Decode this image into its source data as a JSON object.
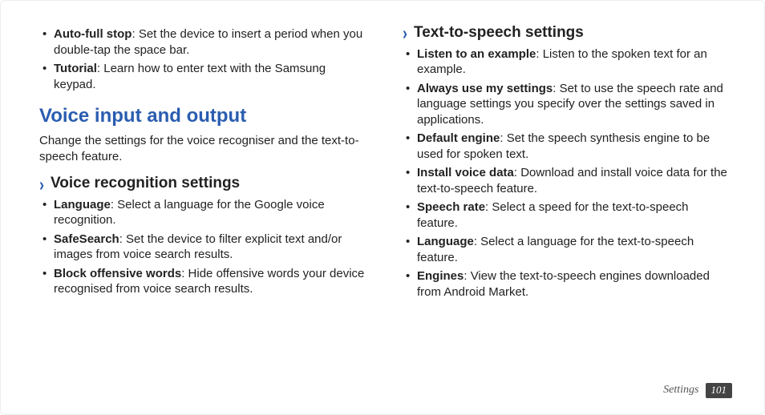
{
  "left": {
    "top_bullets": [
      {
        "term": "Auto-full stop",
        "desc": ": Set the device to insert a period when you double-tap the space bar."
      },
      {
        "term": "Tutorial",
        "desc": ": Learn how to enter text with the Samsung keypad."
      }
    ],
    "section_title": "Voice input and output",
    "section_intro": "Change the settings for the voice recogniser and the text-to-speech feature.",
    "sub1_title": "Voice recognition settings",
    "sub1_bullets": [
      {
        "term": "Language",
        "desc": ": Select a language for the Google voice recognition."
      },
      {
        "term": "SafeSearch",
        "desc": ": Set the device to filter explicit text and/or images from voice search results."
      },
      {
        "term": "Block offensive words",
        "desc": ": Hide offensive words your device recognised from voice search results."
      }
    ]
  },
  "right": {
    "sub2_title": "Text-to-speech settings",
    "sub2_bullets": [
      {
        "term": "Listen to an example",
        "desc": ": Listen to the spoken text for an example."
      },
      {
        "term": "Always use my settings",
        "desc": ": Set to use the speech rate and language settings you specify over the settings saved in applications."
      },
      {
        "term": "Default engine",
        "desc": ": Set the speech synthesis engine to be used for spoken text."
      },
      {
        "term": "Install voice data",
        "desc": ": Download and install voice data for the text-to-speech feature."
      },
      {
        "term": "Speech rate",
        "desc": ": Select a speed for the text-to-speech feature."
      },
      {
        "term": "Language",
        "desc": ": Select a language for the text-to-speech feature."
      },
      {
        "term": "Engines",
        "desc": ": View the text-to-speech engines downloaded from Android Market."
      }
    ]
  },
  "footer": {
    "label": "Settings",
    "page": "101"
  }
}
